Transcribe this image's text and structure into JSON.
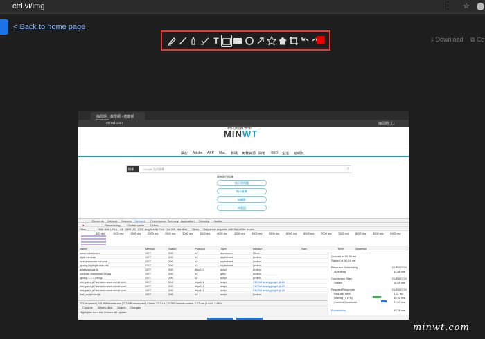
{
  "browser": {
    "url_host": "ctrl.vi",
    "url_path": "/img"
  },
  "back_link": "< Back to home page",
  "toolbar": {
    "accent_color": "#e53935",
    "swatch_color": "#e60000",
    "tools": [
      "highlighter-icon",
      "line-icon",
      "pen-icon",
      "marker-icon",
      "text-icon",
      "rect-outline-icon",
      "rect-filled-icon",
      "circle-icon",
      "arrow-icon",
      "star-icon",
      "home-icon",
      "crop-icon",
      "undo-icon",
      "redo-icon",
      "color-swatch"
    ],
    "text_tool_glyph": "T"
  },
  "download_label": "Download",
  "copy_label": "Co",
  "screenshot": {
    "tab_title": "梅問題．教學網 - 痞客邦PIXNET",
    "url": "minwt.com",
    "profile_text": "梅問題(尤)",
    "logo": "MIN",
    "logo_accent": "WT",
    "logo_cn": "梅問題教學網",
    "nav": [
      "攝影",
      "Adobe",
      "APP",
      "Mac",
      "數碼",
      "免費資源",
      "開箱",
      "SEO",
      "生活",
      "給網友"
    ],
    "search_btn": "搜尋",
    "search_hint": "Google 站內搜尋",
    "recommend_title": "最新熱門搜尋",
    "pills": [
      "梅干問問題",
      "梅干推薦",
      "梅攝影",
      "梅電話"
    ],
    "devtools": {
      "tabs": [
        "Elements",
        "Console",
        "Sources",
        "Network",
        "Performance",
        "Memory",
        "Application",
        "Security",
        "Audits"
      ],
      "toolbar": [
        "Preserve log",
        "Disable cache",
        "Online"
      ],
      "filter": [
        "Filter",
        "Hide data URLs",
        "All",
        "XHR",
        "JS",
        "CSS",
        "Img",
        "Media",
        "Font",
        "Doc",
        "WS",
        "Manifest",
        "Other",
        "Only show requests with SameSite issues"
      ],
      "ticks": [
        "500 ms",
        "1000 ms",
        "1500 ms",
        "2000 ms",
        "2500 ms",
        "3000 ms",
        "3500 ms",
        "4000 ms",
        "4500 ms",
        "5000 ms",
        "5500 ms",
        "6000 ms",
        "6500 ms",
        "7000 ms",
        "7500 ms",
        "8000 ms",
        "8500 ms",
        "9000 ms"
      ],
      "columns": [
        "Name",
        "Method",
        "Status",
        "Protocol",
        "Type",
        "Initiator",
        "Size",
        "Time",
        "Waterfall"
      ],
      "rows": [
        [
          "www.minwt.com",
          "GET",
          "200",
          "h2",
          "document",
          "Other"
        ],
        [
          "style.min.css",
          "GET",
          "200",
          "h2",
          "stylesheet",
          "(index)"
        ],
        [
          "font-awesome.min.css",
          "GET",
          "200",
          "h2",
          "stylesheet",
          "(index)"
        ],
        [
          "jquery-highlight.min.css",
          "GET",
          "200",
          "h2",
          "stylesheet",
          "(index)"
        ],
        [
          "adsbygoogle.js",
          "GET",
          "200",
          "http/1.1",
          "script",
          "(index)"
        ],
        [
          "youtube-thumbnail-38.jpg",
          "GET",
          "200",
          "h2",
          "jpeg",
          "(index)"
        ],
        [
          "jquery-1.7.1.min.js",
          "GET",
          "200",
          "h2",
          "script",
          "(index)"
        ],
        [
          "integrator.js?domain=www.minwt.com",
          "GET",
          "200",
          "http/1.1",
          "script",
          "VM758 adsbygoogle.js:20"
        ],
        [
          "integrator.js?domain=www.minwt.com",
          "GET",
          "200",
          "http/1.1",
          "script",
          "VM758 adsbygoogle.js:20"
        ],
        [
          "integrator.js?domain=www.minwt.com",
          "GET",
          "200",
          "http/1.1",
          "script",
          "VM758 adsbygoogle.js:20"
        ],
        [
          "Inst_script.min.js",
          "GET",
          "200",
          "h2",
          "script",
          "(index)"
        ]
      ],
      "status_bar": "207 requests | 3.8 MB transferred | 7.7 MB resources | Finish: 23.01 s | DOMContentLoaded: 4.17 ms | Load: 7.86 s",
      "console_tabs": [
        "Console",
        "What's New",
        "Search",
        "Changes"
      ],
      "highlights": "Highlights from the Chrome 80 update",
      "detail": {
        "queued": "Queued at 80.86 ms",
        "started": "Started at 96.84 ms",
        "resource": "Resource Scheduling",
        "queueing": "Queueing",
        "queueing_t": "14.88 ms",
        "conn_start": "Connection Start",
        "stalled": "Stalled",
        "stalled_t": "10.49 ms",
        "req": "Request/Response",
        "sent": "Request sent",
        "sent_t": "0.21 ms",
        "waiting": "Waiting (TTFB)",
        "waiting_t": "40.92 ms",
        "content": "Content Download",
        "content_t": "27.47 ms",
        "duration_label": "DURATION",
        "explanation": "Explanation",
        "total": "93.28 ms"
      }
    }
  },
  "watermark": "minwt.com"
}
